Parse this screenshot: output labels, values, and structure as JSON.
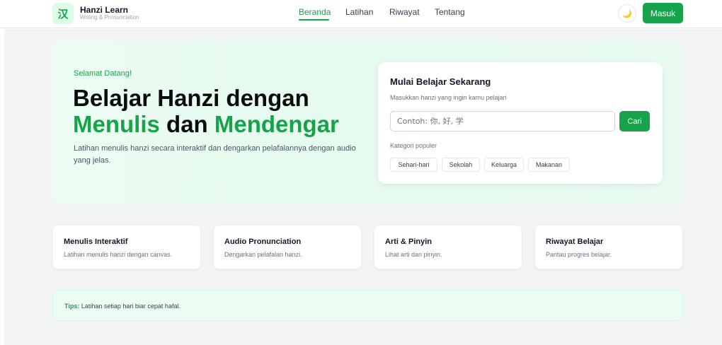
{
  "header": {
    "logo_glyph": "汉",
    "brand_name": "Hanzi Learn",
    "brand_sub": "Writing & Pronunciation",
    "nav": [
      {
        "label": "Beranda",
        "active": true
      },
      {
        "label": "Latihan",
        "active": false
      },
      {
        "label": "Riwayat",
        "active": false
      },
      {
        "label": "Tentang",
        "active": false
      }
    ],
    "theme_icon": "🌙",
    "login_label": "Masuk"
  },
  "hero": {
    "welcome": "Selamat Datang!",
    "title_line1": "Belajar Hanzi dengan",
    "title_word_write": "Menulis",
    "title_word_and": "dan",
    "title_word_listen": "Mendengar",
    "description": "Latihan menulis hanzi secara interaktif dan dengarkan pelafalannya dengan audio yang jelas."
  },
  "search_card": {
    "title": "Mulai Belajar Sekarang",
    "subtitle": "Masukkan hanzi yang ingin kamu pelajari",
    "input_placeholder": "Contoh: 你, 好, 学",
    "input_value": "",
    "button_label": "Cari",
    "category_label": "Kategori populer",
    "categories": [
      "Sehari-hari",
      "Sekolah",
      "Keluarga",
      "Makanan"
    ]
  },
  "features": [
    {
      "title": "Menulis Interaktif",
      "desc": "Latihan menulis hanzi dengan canvas."
    },
    {
      "title": "Audio Pronunciation",
      "desc": "Dengarkan pelafalan hanzi."
    },
    {
      "title": "Arti & Pinyin",
      "desc": "Lihat arti dan pinyin."
    },
    {
      "title": "Riwayat Belajar",
      "desc": "Pantau progres belajar."
    }
  ],
  "tips": {
    "label": "Tips:",
    "text": "Latihan setiap hari biar cepat hafal."
  },
  "colors": {
    "accent": "#16a34a",
    "hero_bg": "#ecfdf3",
    "page_bg": "#f3f4f6"
  }
}
